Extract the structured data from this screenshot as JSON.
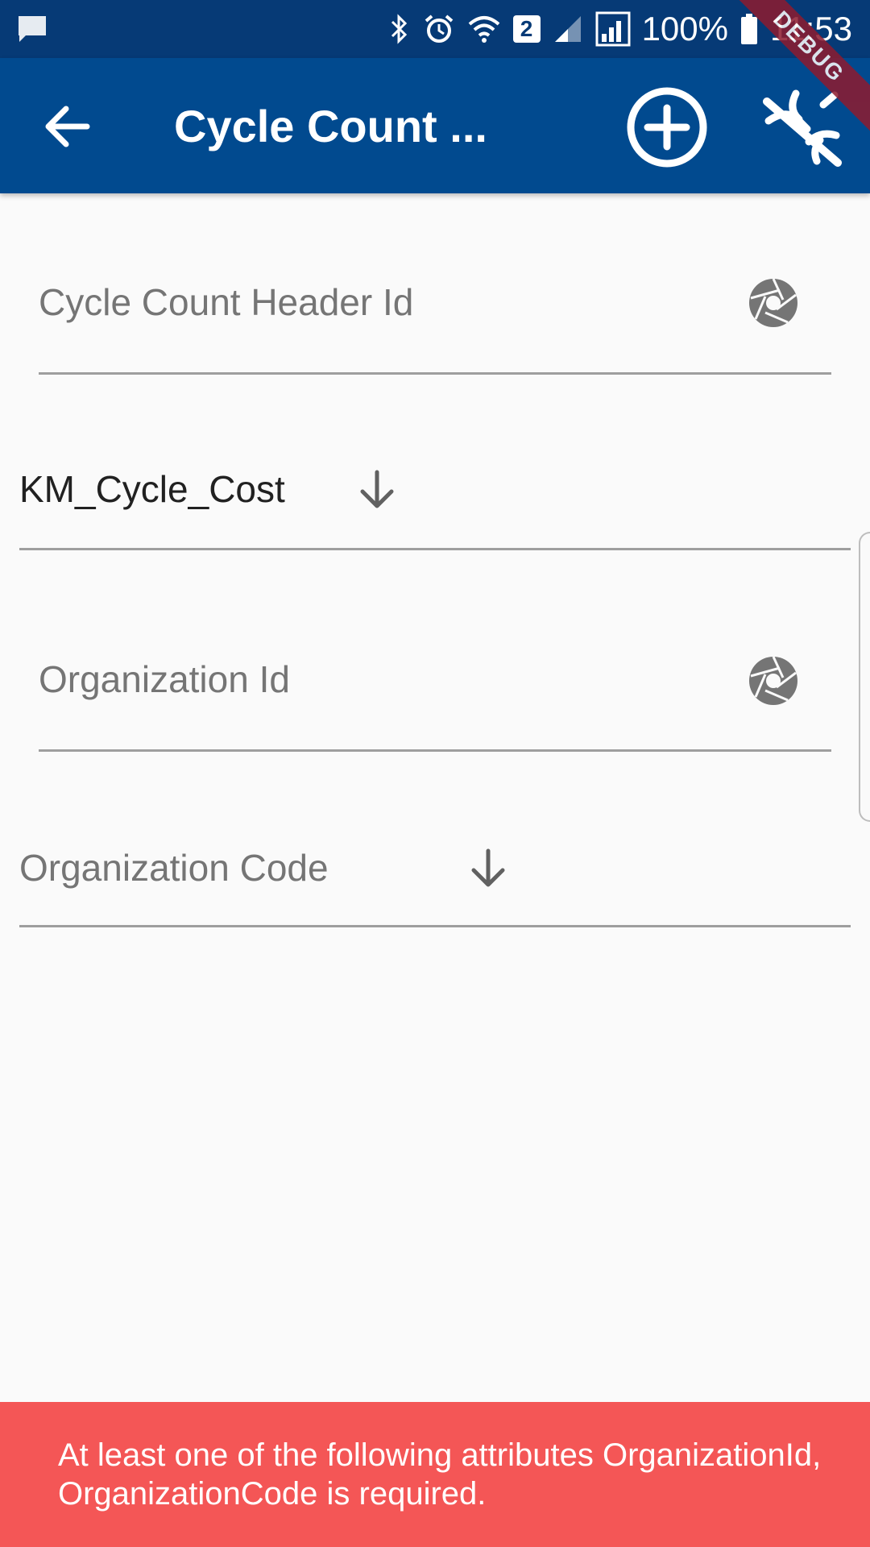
{
  "status_bar": {
    "battery_percent": "100%",
    "time": "11:53",
    "sim_badge": "2",
    "icons": [
      "message-icon",
      "bluetooth-icon",
      "alarm-icon",
      "wifi-icon",
      "signal-icon",
      "signal-icon",
      "battery-icon"
    ]
  },
  "app_bar": {
    "title": "Cycle Count ...",
    "background": "#014a8f",
    "icons": [
      "back-arrow-icon",
      "add-circle-icon",
      "tools-off-icon"
    ]
  },
  "debug_banner": "DEBUG",
  "form": {
    "header_id": {
      "placeholder": "Cycle Count Header Id",
      "icon": "camera-shutter-icon"
    },
    "cycle_dropdown": {
      "value": "KM_Cycle_Cost",
      "icon": "arrow-down-icon"
    },
    "organization_id": {
      "placeholder": "Organization Id",
      "icon": "camera-shutter-icon"
    },
    "organization_code": {
      "placeholder": "Organization Code",
      "icon": "arrow-down-icon"
    }
  },
  "snackbar": {
    "message": "At least one of the following attributes OrganizationId, OrganizationCode is required.",
    "background": "#f45656"
  }
}
